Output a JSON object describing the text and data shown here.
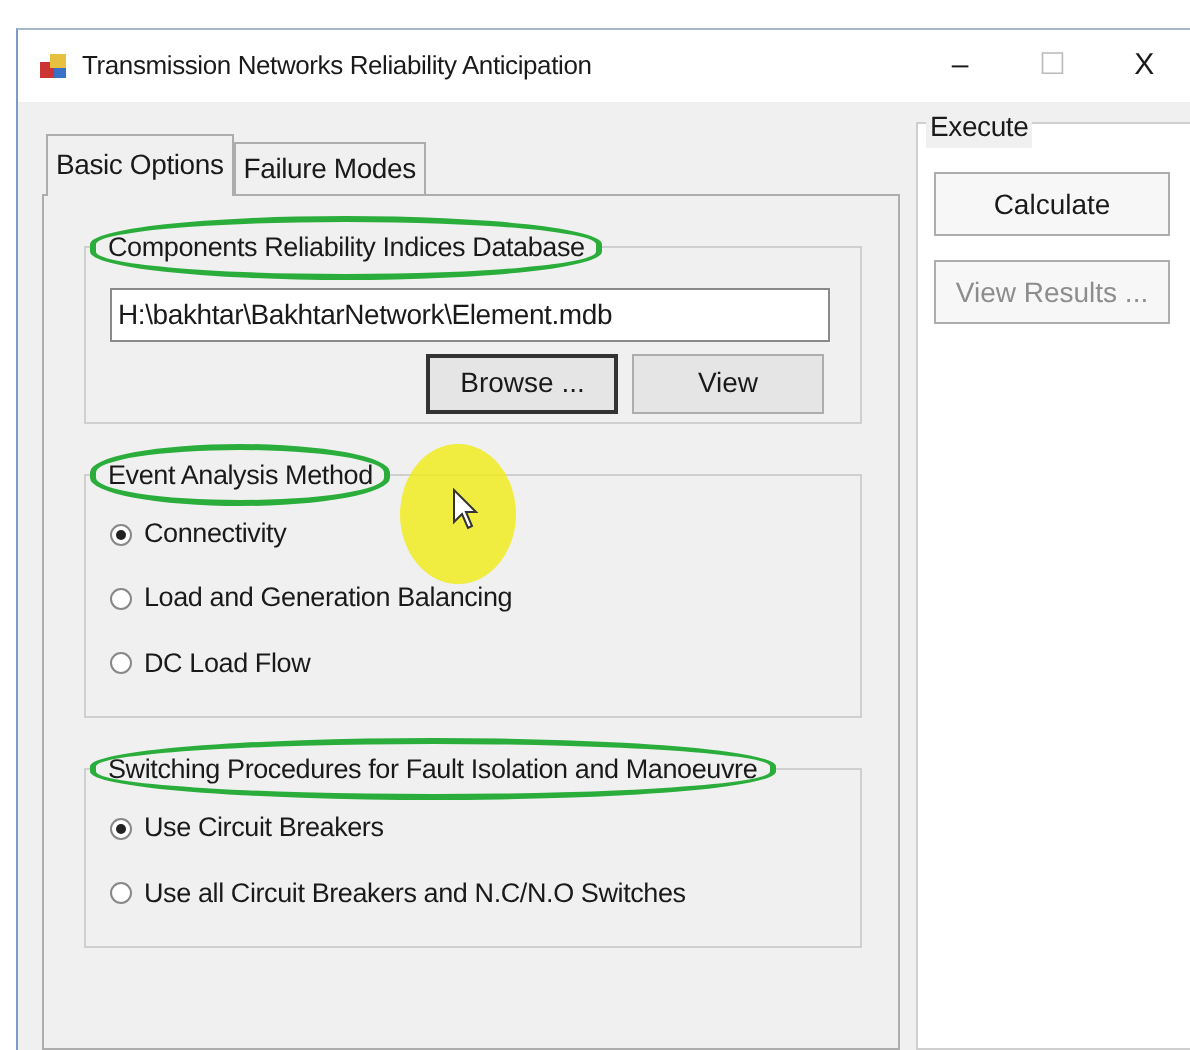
{
  "window": {
    "title": "Transmission Networks Reliability Anticipation",
    "controls": [
      "–",
      "☐",
      "X"
    ]
  },
  "tabs": [
    {
      "label": "Basic Options",
      "selected": true
    },
    {
      "label": "Failure Modes",
      "selected": false
    }
  ],
  "database_group": {
    "title": "Components Reliability Indices Database",
    "highlighted": true,
    "path": "H:\\bakhtar\\BakhtarNetwork\\Element.mdb",
    "buttons": [
      {
        "label": "Browse ...",
        "focused": true
      },
      {
        "label": "View",
        "focused": false
      }
    ]
  },
  "method_group": {
    "title": "Event Analysis Method",
    "highlighted": true,
    "options": [
      {
        "label": "Connectivity",
        "selected": true
      },
      {
        "label": "Load and Generation Balancing",
        "selected": false
      },
      {
        "label": "DC Load Flow",
        "selected": false
      }
    ]
  },
  "switching_group": {
    "title": "Switching Procedures for Fault Isolation and Manoeuvre",
    "highlighted": true,
    "options": [
      {
        "label": "Use Circuit Breakers",
        "selected": true
      },
      {
        "label": "Use all Circuit Breakers and N.C/N.O Switches",
        "selected": false
      }
    ]
  },
  "execute_group": {
    "title": "Execute",
    "buttons": [
      {
        "label": "Calculate",
        "disabled": false
      },
      {
        "label": "View Results ...",
        "disabled": true
      }
    ]
  }
}
